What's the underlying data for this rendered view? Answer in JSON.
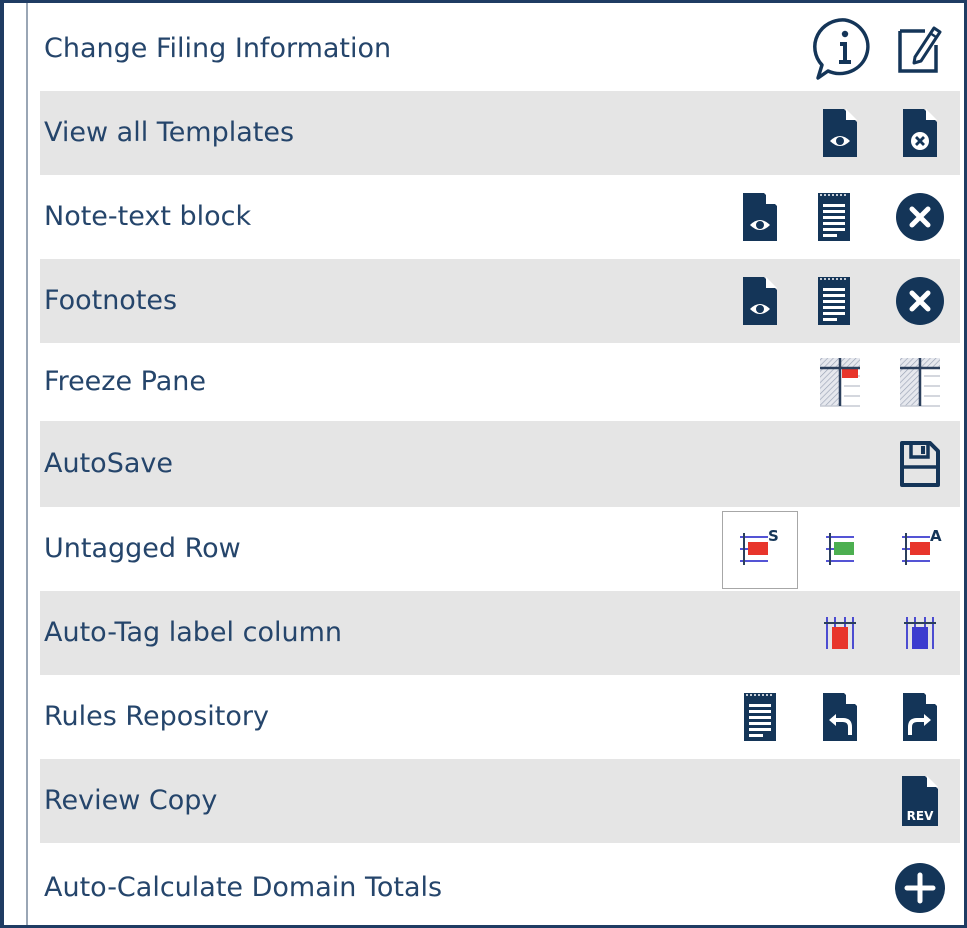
{
  "colors": {
    "icon_navy": "#143558",
    "label_text": "#25456b",
    "frame_border": "#1f3c63",
    "row_alt_bg": "#e5e5e5",
    "accent_red": "#e8352b",
    "accent_green": "#4caf50",
    "accent_blue": "#3c3ccf"
  },
  "rows": [
    {
      "label": "Change Filing Information",
      "icons": [
        "info-speech-icon",
        "edit-note-icon"
      ]
    },
    {
      "label": "View all Templates",
      "icons": [
        "file-view-icon",
        "file-remove-icon"
      ]
    },
    {
      "label": "Note-text block",
      "icons": [
        "file-view-icon",
        "notes-list-icon",
        "close-circle-icon"
      ]
    },
    {
      "label": "Footnotes",
      "icons": [
        "file-view-icon",
        "notes-list-icon",
        "close-circle-icon"
      ]
    },
    {
      "label": "Freeze Pane",
      "icons": [
        "freeze-pane-on-icon",
        "freeze-pane-off-icon"
      ]
    },
    {
      "label": "AutoSave",
      "icons": [
        "save-icon"
      ]
    },
    {
      "label": "Untagged Row",
      "icons": [
        "row-tag-s-icon",
        "row-tag-green-icon",
        "row-tag-a-icon"
      ],
      "selected": "row-tag-s-icon"
    },
    {
      "label": "Auto-Tag label column",
      "icons": [
        "column-tag-red-icon",
        "column-tag-blue-icon"
      ]
    },
    {
      "label": "Rules Repository",
      "icons": [
        "notes-list-icon",
        "file-undo-icon",
        "file-redo-icon"
      ]
    },
    {
      "label": "Review Copy",
      "icons": [
        "review-file-icon"
      ],
      "review_badge": "REV"
    },
    {
      "label": "Auto-Calculate Domain Totals",
      "icons": [
        "add-circle-icon"
      ]
    }
  ]
}
